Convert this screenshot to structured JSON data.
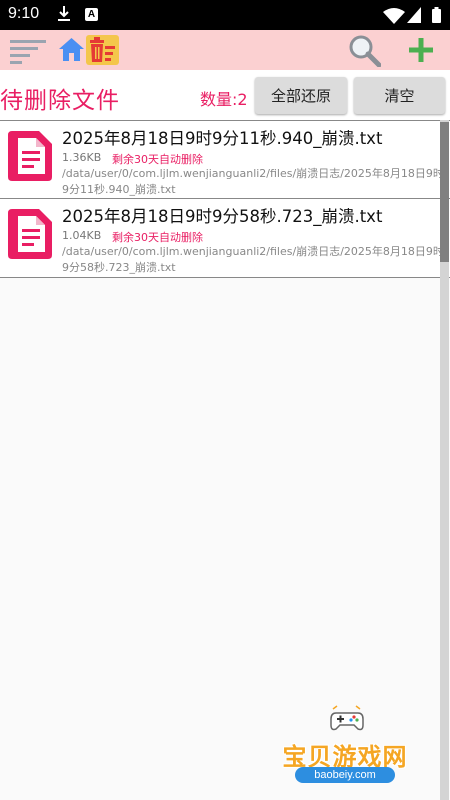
{
  "status_bar": {
    "time": "9:10",
    "a_badge": "A"
  },
  "toolbar": {
    "icons": [
      "menu-icon",
      "home-icon",
      "trash-icon",
      "search-icon",
      "add-icon"
    ]
  },
  "header": {
    "title": "待删除文件",
    "count_label": "数量:2",
    "restore_all_label": "全部还原",
    "clear_label": "清空"
  },
  "files": [
    {
      "name": "2025年8月18日9时9分11秒.940_崩溃.txt",
      "size": "1.36KB",
      "expire": "剩余30天自动删除",
      "path": "/data/user/0/com.ljlm.wenjianguanli2/files/崩溃日志/2025年8月18日9时9分11秒.940_崩溃.txt"
    },
    {
      "name": "2025年8月18日9时9分58秒.723_崩溃.txt",
      "size": "1.04KB",
      "expire": "剩余30天自动删除",
      "path": "/data/user/0/com.ljlm.wenjianguanli2/files/崩溃日志/2025年8月18日9时9分58秒.723_崩溃.txt"
    }
  ],
  "watermark": {
    "text": "宝贝游戏网",
    "url": "baobeiy.com"
  },
  "colors": {
    "accent": "#e91e63",
    "toolbar_bg": "#fbd0d1",
    "trash_tab_bg": "#f4c64b",
    "add_green": "#4caf50",
    "home_blue": "#4a8ff2"
  }
}
